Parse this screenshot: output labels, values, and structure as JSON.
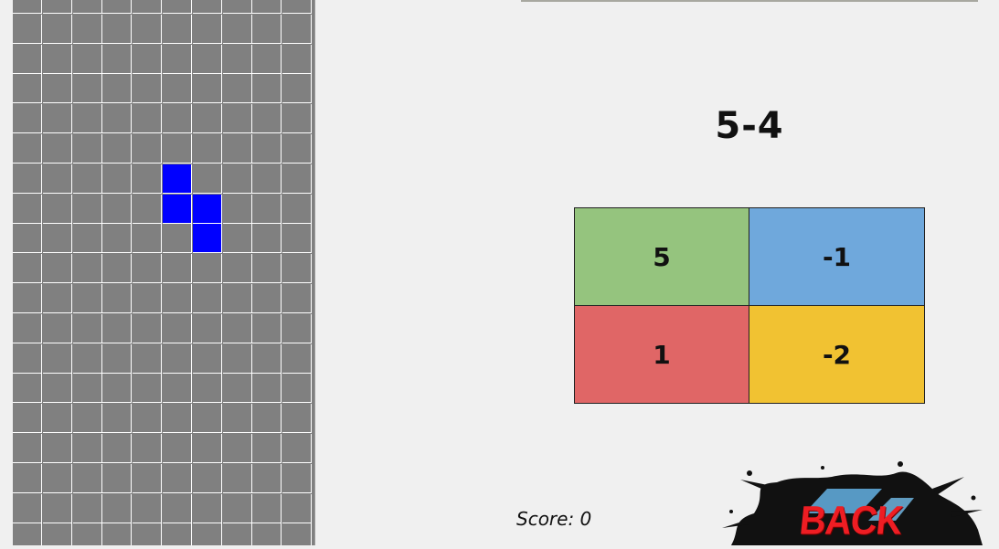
{
  "board": {
    "columns": 10,
    "rows": 19,
    "background_color": "#808080",
    "grid_color": "#ffffff",
    "piece_color": "#0000ff",
    "filled_cells": [
      [
        5,
        6
      ],
      [
        5,
        7
      ],
      [
        6,
        7
      ],
      [
        6,
        8
      ]
    ]
  },
  "question": {
    "text": "5-4"
  },
  "answers": [
    {
      "label": "5",
      "color": "#95c47e"
    },
    {
      "label": "-1",
      "color": "#6fa8dc"
    },
    {
      "label": "1",
      "color": "#e06666"
    },
    {
      "label": "-2",
      "color": "#f1c232"
    }
  ],
  "score": {
    "text": "Score: 0"
  },
  "back_button": {
    "label": "BACK",
    "icon": "paint-splash-icon"
  }
}
